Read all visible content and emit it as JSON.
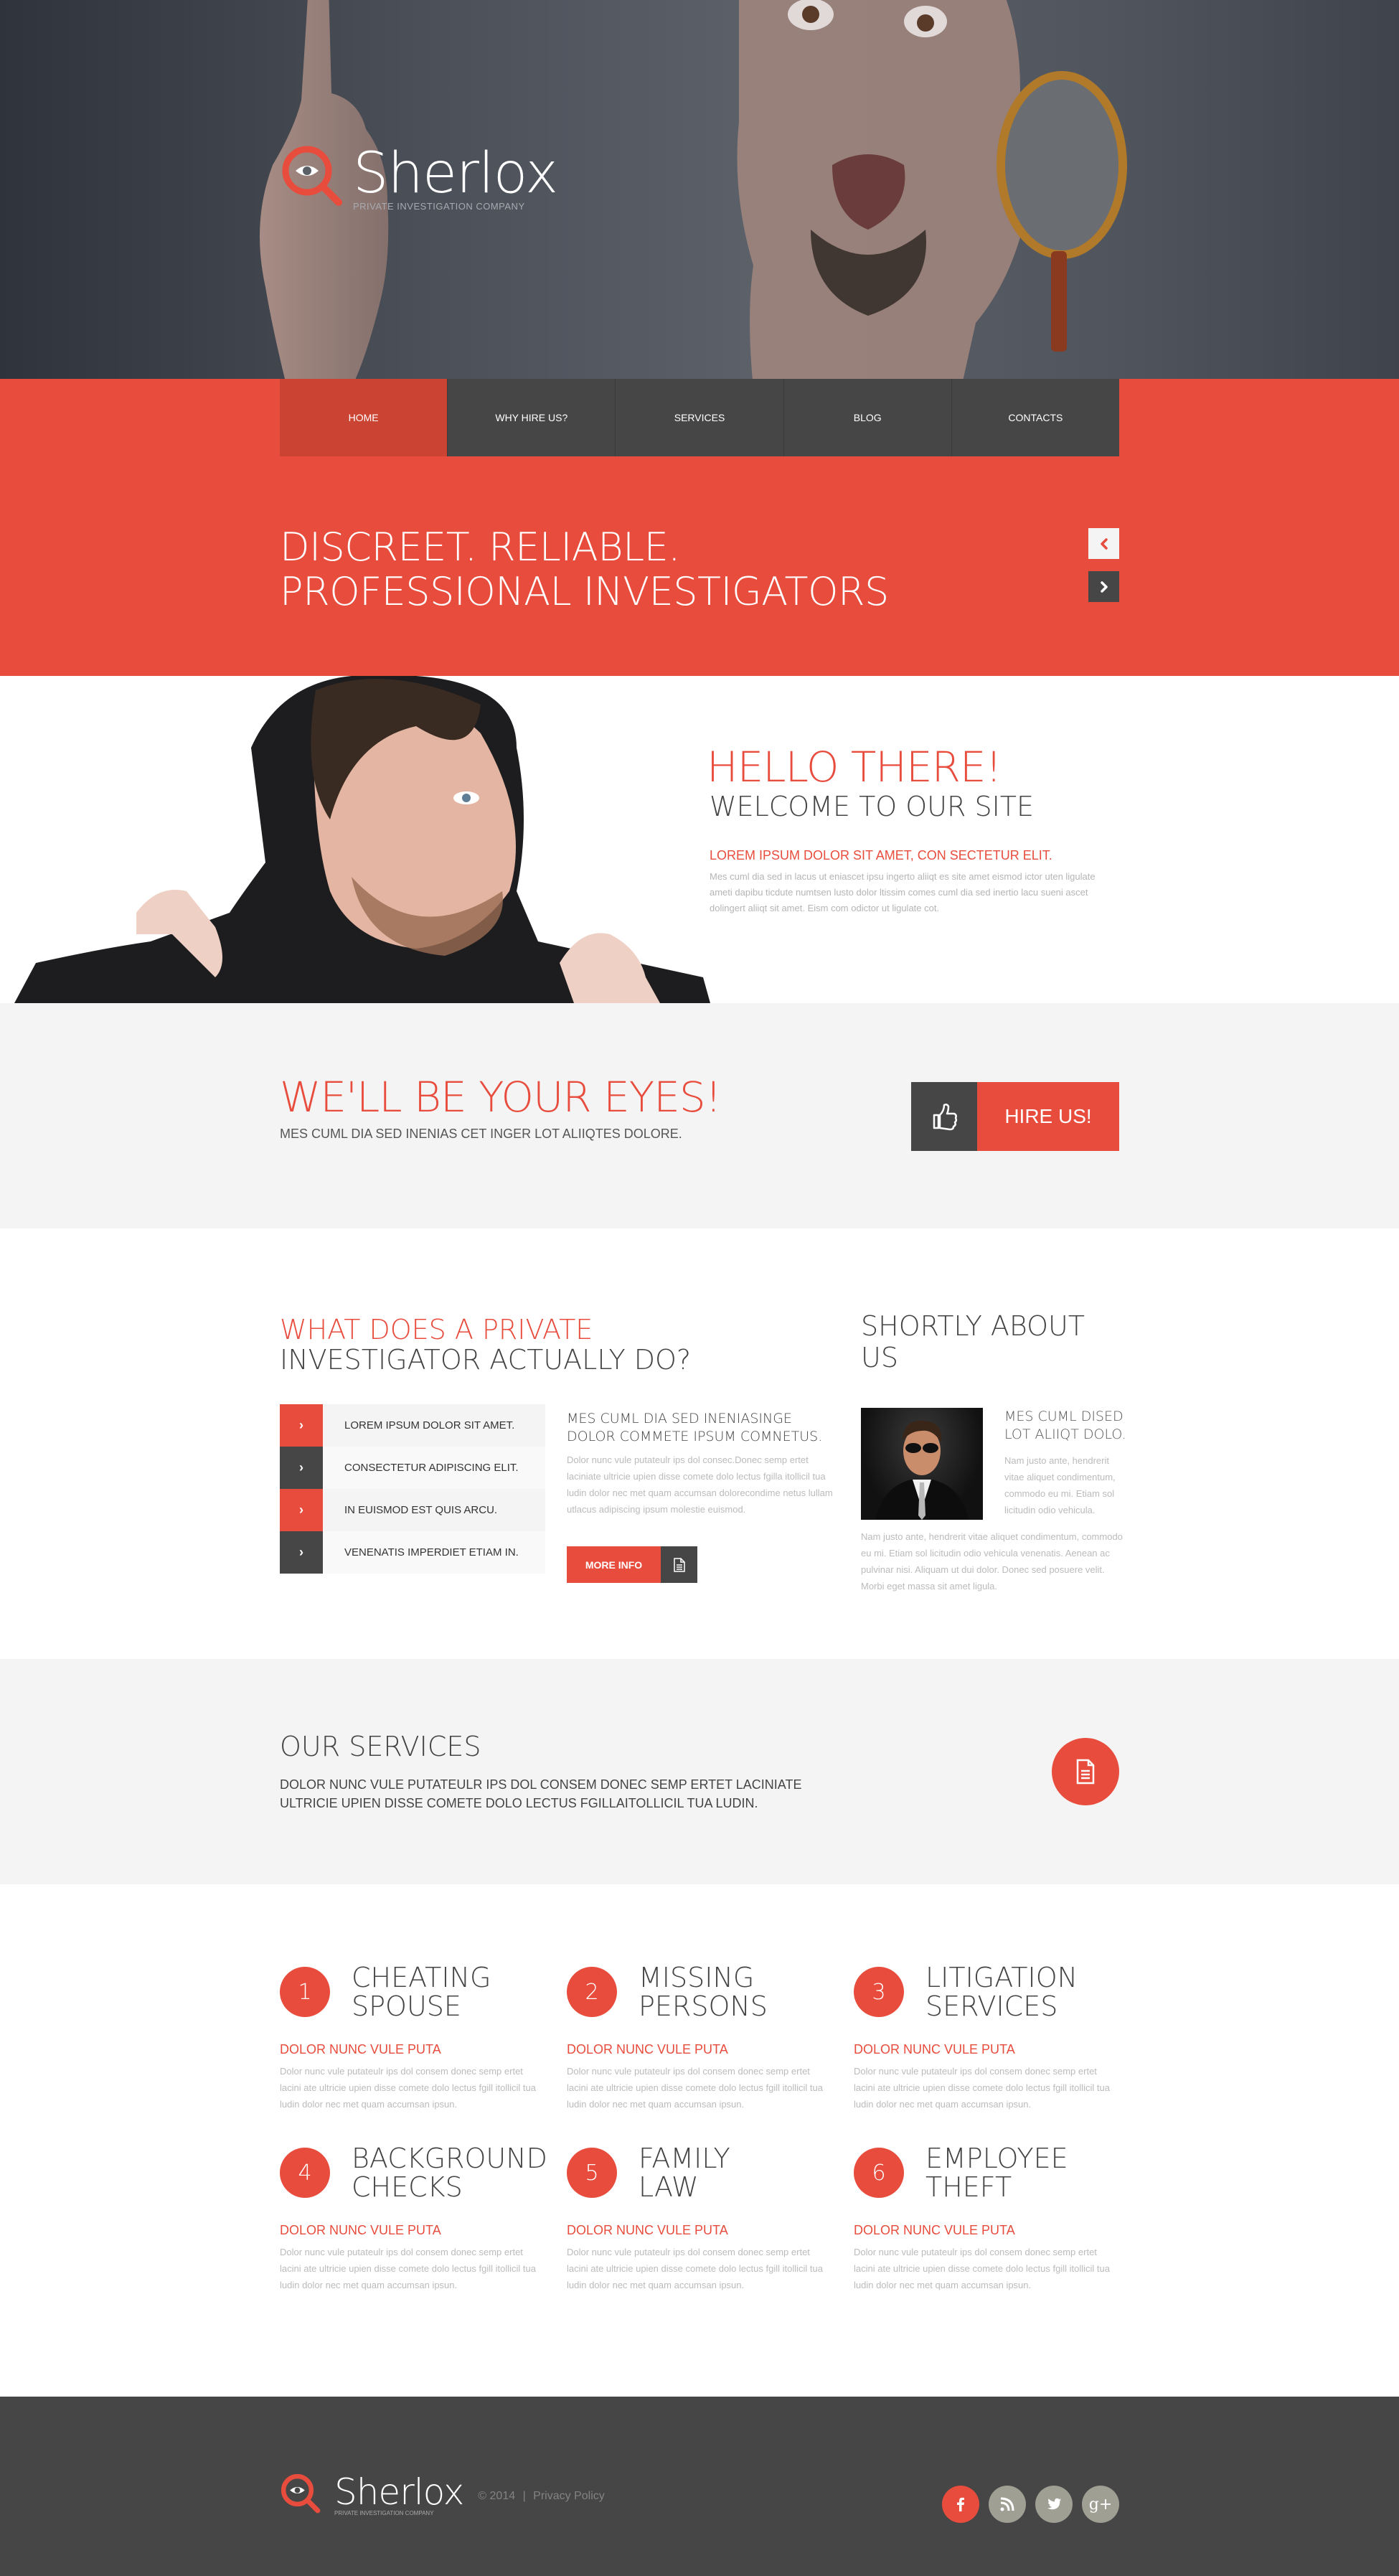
{
  "brand": {
    "name": "Sherlox",
    "tagline": "PRIVATE INVESTIGATION COMPANY"
  },
  "nav": {
    "items": [
      {
        "label": "HOME",
        "active": true
      },
      {
        "label": "WHY HIRE US?"
      },
      {
        "label": "SERVICES"
      },
      {
        "label": "BLOG"
      },
      {
        "label": "CONTACTS"
      }
    ]
  },
  "slider": {
    "line1": "DISCREET. RELIABLE.",
    "line2": "PROFESSIONAL INVESTIGATORS",
    "prev_icon": "chevron-left-icon",
    "next_icon": "chevron-right-icon"
  },
  "hello": {
    "title": "HELLO THERE!",
    "subtitle": "WELCOME TO OUR SITE",
    "lead": "LOREM IPSUM DOLOR SIT AMET, CON SECTETUR ELIT.",
    "body": "Mes cuml dia sed in lacus ut eniascet ipsu ingerto aliiqt es site amet eismod ictor uten ligulate ameti dapibu ticdute numtsen lusto dolor ltissim comes cuml dia sed inertio lacu sueni ascet dolingert aliiqt sit amet. Eism com odictor ut ligulate cot."
  },
  "eyes": {
    "title": "WE'LL BE YOUR EYES!",
    "subtitle": "MES CUML DIA SED INENIAS CET INGER LOT ALIIQTES DOLORE.",
    "button_label": "HIRE US!",
    "button_icon": "thumbs-up-icon"
  },
  "what": {
    "title_red": "WHAT DOES A PRIVATE",
    "title_dark": "INVESTIGATOR ACTUALLY DO?",
    "list": [
      "LOREM IPSUM DOLOR SIT AMET.",
      "CONSECTETUR ADIPISCING ELIT.",
      "IN EUISMOD EST QUIS ARCU.",
      "VENENATIS IMPERDIET ETIAM IN."
    ],
    "mid_title": "MES CUML DIA SED INENIASINGE DOLOR COMMETE IPSUM COMNETUS.",
    "mid_body": "Dolor nunc vule putateulr ips dol consec.Donec semp ertet laciniate ultricie upien disse comete dolo lectus fgilla itollicil tua ludin dolor nec met quam accumsan dolorecondime netus lullam utlacus adipiscing ipsum molestie euismod.",
    "more_label": "MORE INFO",
    "more_icon": "document-icon"
  },
  "about": {
    "title": "SHORTLY ABOUT US",
    "side_title": "MES CUML DISED LOT ALIIQT DOLO.",
    "side_body": "Nam justo ante, hendrerit vitae aliquet condimentum, commodo eu mi. Etiam sol licitudin odio vehicula.",
    "body": "Nam justo ante, hendrerit vitae aliquet condimentum, commodo eu mi. Etiam sol licitudin odio vehicula venenatis. Aenean ac pulvinar nisi. Aliquam ut dui dolor. Donec sed posuere velit. Morbi eget massa sit amet ligula."
  },
  "services_head": {
    "title": "OUR SERVICES",
    "body": "DOLOR NUNC VULE PUTATEULR IPS DOL CONSEM DONEC SEMP ERTET LACINIATE ULTRICIE UPIEN DISSE COMETE DOLO LECTUS FGILLAITOLLICIL TUA LUDIN.",
    "icon": "document-icon"
  },
  "services": [
    {
      "num": "1",
      "title1": "CHEATING",
      "title2": "SPOUSE",
      "sub": "DOLOR NUNC VULE PUTA",
      "body": "Dolor nunc vule putateulr ips dol consem donec semp ertet lacini ate ultricie upien disse comete dolo lectus fgill itollicil tua ludin dolor nec met quam accumsan ipsun."
    },
    {
      "num": "2",
      "title1": "MISSING",
      "title2": "PERSONS",
      "sub": "DOLOR NUNC VULE PUTA",
      "body": "Dolor nunc vule putateulr ips dol consem donec semp ertet lacini ate ultricie upien disse comete dolo lectus fgill itollicil tua ludin dolor nec met quam accumsan ipsun."
    },
    {
      "num": "3",
      "title1": "LITIGATION",
      "title2": "SERVICES",
      "sub": "DOLOR NUNC VULE PUTA",
      "body": "Dolor nunc vule putateulr ips dol consem donec semp ertet lacini ate ultricie upien disse comete dolo lectus fgill itollicil tua ludin dolor nec met quam accumsan ipsun."
    },
    {
      "num": "4",
      "title1": "BACKGROUND",
      "title2": "CHECKS",
      "sub": "DOLOR NUNC VULE PUTA",
      "body": "Dolor nunc vule putateulr ips dol consem donec semp ertet lacini ate ultricie upien disse comete dolo lectus fgill itollicil tua ludin dolor nec met quam accumsan ipsun."
    },
    {
      "num": "5",
      "title1": "FAMILY",
      "title2": "LAW",
      "sub": "DOLOR NUNC VULE PUTA",
      "body": "Dolor nunc vule putateulr ips dol consem donec semp ertet lacini ate ultricie upien disse comete dolo lectus fgill itollicil tua ludin dolor nec met quam accumsan ipsun."
    },
    {
      "num": "6",
      "title1": "EMPLOYEE",
      "title2": "THEFT",
      "sub": "DOLOR NUNC VULE PUTA",
      "body": "Dolor nunc vule putateulr ips dol consem donec semp ertet lacini ate ultricie upien disse comete dolo lectus fgill itollicil tua ludin dolor nec met quam accumsan ipsun."
    }
  ],
  "footer": {
    "name": "Sherlox",
    "tagline": "PRIVATE INVESTIGATION COMPANY",
    "copyright": "© 2014",
    "separator": "|",
    "privacy": "Privacy Policy",
    "social": [
      {
        "name": "facebook-icon",
        "glyph": "f"
      },
      {
        "name": "rss-icon"
      },
      {
        "name": "twitter-icon"
      },
      {
        "name": "google-plus-icon",
        "glyph": "g+"
      }
    ]
  },
  "colors": {
    "accent": "#e84c3d",
    "dark": "#464646",
    "light_bg": "#f4f4f4",
    "social_gray": "#a09f94"
  }
}
